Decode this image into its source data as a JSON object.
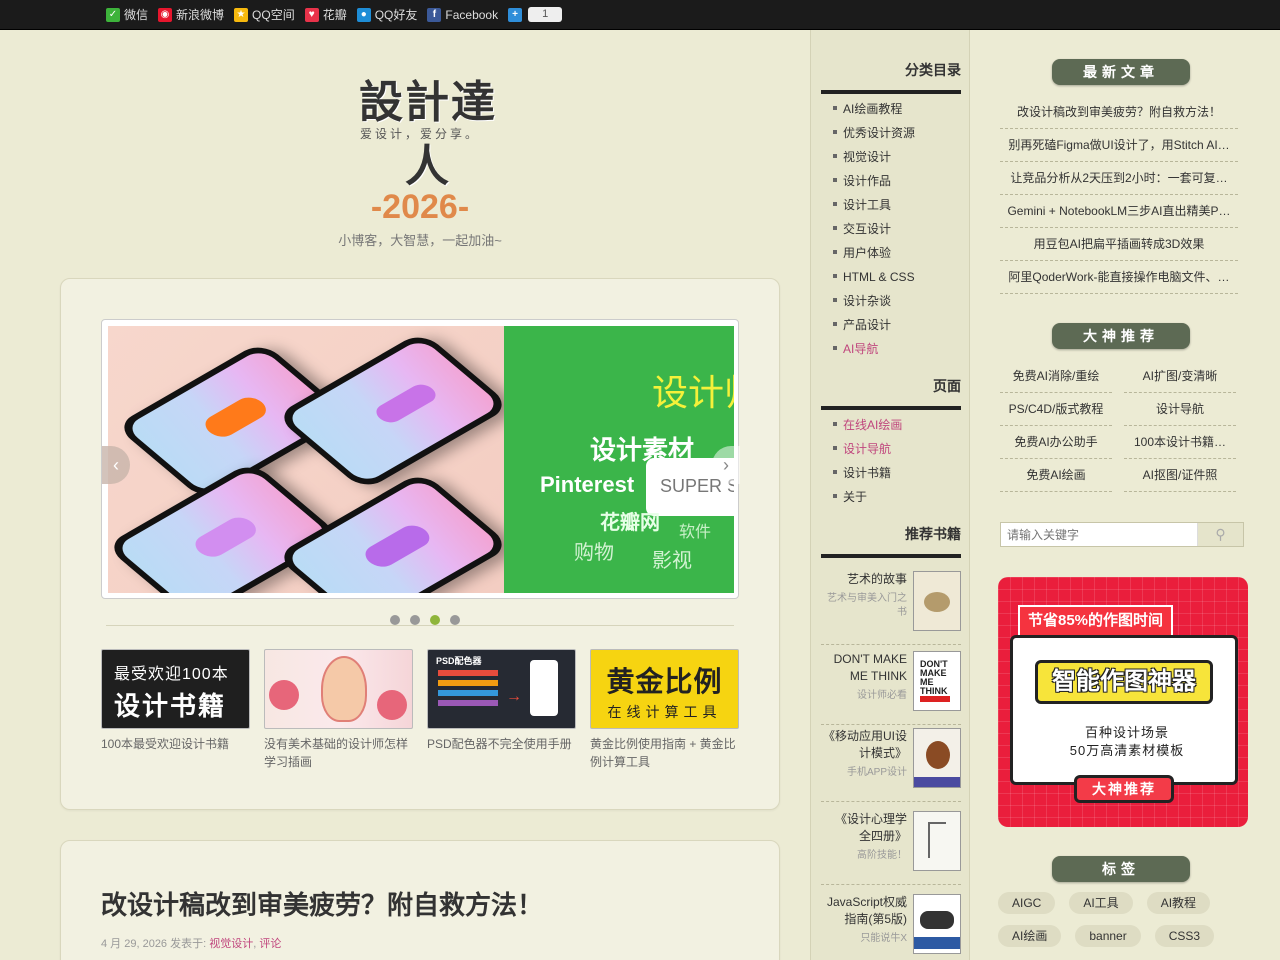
{
  "share_bar": {
    "items": [
      {
        "label": "微信",
        "icon": "wechat-icon",
        "color": "#3db33b"
      },
      {
        "label": "新浪微博",
        "icon": "weibo-icon",
        "color": "#e6162d"
      },
      {
        "label": "QQ空间",
        "icon": "qzone-icon",
        "color": "#f7b90e"
      },
      {
        "label": "花瓣",
        "icon": "huaban-icon",
        "color": "#e8334a"
      },
      {
        "label": "QQ好友",
        "icon": "qq-icon",
        "color": "#1e8dd6"
      },
      {
        "label": "Facebook",
        "icon": "facebook-icon",
        "color": "#3b5998"
      }
    ],
    "more_icon": "plus-icon",
    "count": "1"
  },
  "site": {
    "logo": "設計達人",
    "tagline": "爱设计，爱分享。",
    "year": "-2026-",
    "motto": "小博客，大智慧，一起加油~"
  },
  "slider": {
    "left_image": "iphone-mockups",
    "right_title": "设计师",
    "right_sub": "设计素材",
    "right_pin": "Pinterest",
    "right_search": "SUPER S",
    "right_w1": "花瓣网",
    "right_w2": "软件",
    "right_w3": "购物",
    "right_w4": "影视",
    "prev": "‹",
    "next": "›",
    "active_dot": 2
  },
  "thumbs": [
    {
      "line1": "最受欢迎100本",
      "line2": "设计书籍",
      "caption": "100本最受欢迎设计书籍"
    },
    {
      "caption": "没有美术基础的设计师怎样学习插画"
    },
    {
      "label": "PSD配色器",
      "caption": "PSD配色器不完全使用手册"
    },
    {
      "line1": "黄金比例",
      "line2": "在线计算工具",
      "caption": "黄金比例使用指南 + 黄金比例计算工具"
    }
  ],
  "post": {
    "title": "改设计稿改到审美疲劳？附自救方法！",
    "date": "4 月 29, 2026 发表于:",
    "cat1": "视觉设计",
    "cat2": "评论"
  },
  "categories": {
    "heading": "分类目录",
    "items": [
      "AI绘画教程",
      "优秀设计资源",
      "视觉设计",
      "设计作品",
      "设计工具",
      "交互设计",
      "用户体验",
      "HTML & CSS",
      "设计杂谈",
      "产品设计",
      "AI导航"
    ]
  },
  "pages": {
    "heading": "页面",
    "items": [
      "在线AI绘画",
      "设计导航",
      "设计书籍",
      "关于"
    ]
  },
  "books": {
    "heading": "推荐书籍",
    "items": [
      {
        "title": "艺术的故事",
        "desc": "艺术与审美入门之书"
      },
      {
        "title": "DON'T MAKE ME THINK",
        "desc": "设计师必看"
      },
      {
        "title": "《移动应用UI设计模式》",
        "desc": "手机APP设计"
      },
      {
        "title": "《设计心理学 全四册》",
        "desc": "高阶技能！"
      },
      {
        "title": "JavaScript权威指南(第5版)",
        "desc": "只能说牛X"
      }
    ]
  },
  "latest": {
    "heading": "最新文章",
    "items": [
      "改设计稿改到审美疲劳？附自救方法！",
      "别再死磕Figma做UI设计了，用Stitch AI…",
      "让竞品分析从2天压到2小时：一套可复…",
      "Gemini + NotebookLM三步AI直出精美P…",
      "用豆包AI把扁平插画转成3D效果",
      "阿里QoderWork-能直接操作电脑文件、…"
    ]
  },
  "recommend": {
    "heading": "大神推荐",
    "items": [
      "免费AI消除/重绘",
      "AI扩图/变清晰",
      "PS/C4D/版式教程",
      "设计导航",
      "免费AI办公助手",
      "100本设计书籍…",
      "免费AI绘画",
      "AI抠图/证件照"
    ]
  },
  "search": {
    "placeholder": "请输入关键字",
    "icon": "search-icon"
  },
  "ad": {
    "tag": "节省85%的作图时间",
    "title": "智能作图神器",
    "line1": "百种设计场景",
    "line2": "50万高清素材模板",
    "button": "大神推荐"
  },
  "tags": {
    "heading": "标签",
    "items": [
      "AIGC",
      "AI工具",
      "AI教程",
      "AI绘画",
      "banner",
      "CSS3"
    ]
  },
  "colors": {
    "accent_pink": "#c0467d",
    "year_orange": "#e0894a",
    "active_dot": "#8fb53a"
  }
}
